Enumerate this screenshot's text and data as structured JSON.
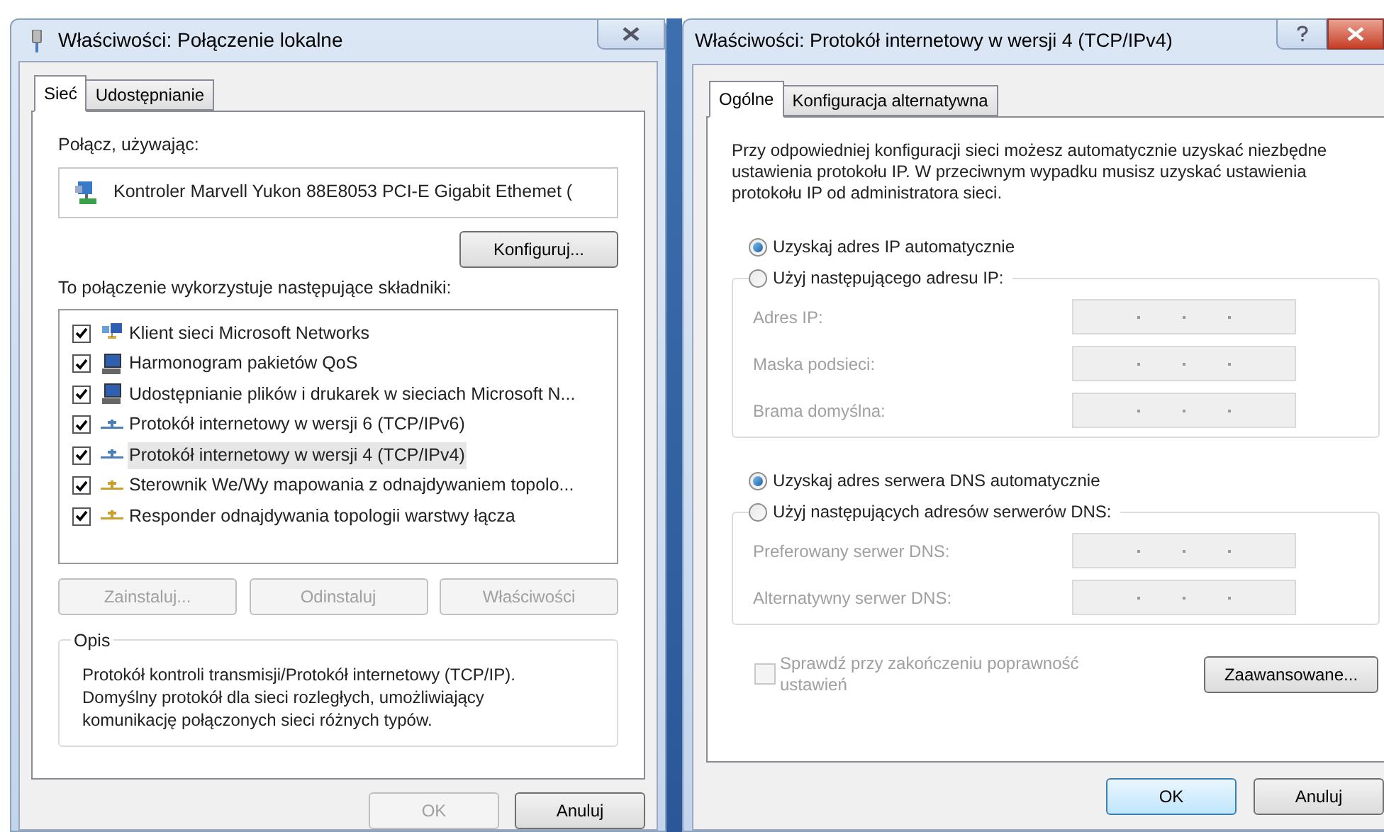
{
  "left_window": {
    "title": "Właściwości: Połączenie lokalne",
    "tabs": [
      {
        "label": "Sieć",
        "selected": true
      },
      {
        "label": "Udostępnianie",
        "selected": false
      }
    ],
    "connect_using_label": "Połącz, używając:",
    "adapter": "Kontroler Marvell Yukon 88E8053 PCI-E Gigabit Ethemet (",
    "configure_button": "Konfiguruj...",
    "components_label": "To połączenie wykorzystuje następujące składniki:",
    "components": [
      {
        "label": "Klient sieci Microsoft Networks",
        "checked": true,
        "selected": false,
        "kind": "client"
      },
      {
        "label": "Harmonogram pakietów QoS",
        "checked": true,
        "selected": false,
        "kind": "computer"
      },
      {
        "label": "Udostępnianie plików i drukarek w sieciach Microsoft N...",
        "checked": true,
        "selected": false,
        "kind": "computer"
      },
      {
        "label": "Protokół internetowy w wersji 6 (TCP/IPv6)",
        "checked": true,
        "selected": false,
        "kind": "ip-protocol"
      },
      {
        "label": "Protokół internetowy w wersji 4 (TCP/IPv4)",
        "checked": true,
        "selected": true,
        "kind": "ip-protocol"
      },
      {
        "label": "Sterownik We/Wy mapowania z odnajdywaniem topolo...",
        "checked": true,
        "selected": false,
        "kind": "protocol"
      },
      {
        "label": "Responder odnajdywania topologii warstwy łącza",
        "checked": true,
        "selected": false,
        "kind": "protocol"
      }
    ],
    "component_buttons": [
      {
        "label": "Zainstaluj...",
        "disabled": true
      },
      {
        "label": "Odinstaluj",
        "disabled": true
      },
      {
        "label": "Właściwości",
        "disabled": true
      }
    ],
    "description_title": "Opis",
    "description": "Protokół kontroli transmisji/Protokół internetowy (TCP/IP). Domyślny protokół dla sieci rozległych, umożliwiający komunikację połączonych sieci różnych typów.",
    "buttons": [
      {
        "label": "OK",
        "disabled": true
      },
      {
        "label": "Anuluj",
        "disabled": false
      }
    ]
  },
  "right_window": {
    "title": "Właściwości: Protokół internetowy w wersji 4 (TCP/IPv4)",
    "tabs": [
      {
        "label": "Ogólne",
        "selected": true
      },
      {
        "label": "Konfiguracja alternatywna",
        "selected": false
      }
    ],
    "intro": "Przy odpowiedniej konfiguracji sieci możesz automatycznie uzyskać niezbędne ustawienia protokołu IP. W przeciwnym wypadku musisz uzyskać ustawienia protokołu IP od administratora sieci.",
    "ip_groups": [
      {
        "auto_option": {
          "label": "Uzyskaj adres IP automatycznie",
          "selected": true
        },
        "manual_option": {
          "label": "Użyj następującego adresu IP:",
          "selected": false
        },
        "fields": [
          {
            "label": "Adres IP:",
            "disabled": true
          },
          {
            "label": "Maska podsieci:",
            "disabled": true
          },
          {
            "label": "Brama domyślna:",
            "disabled": true
          }
        ]
      },
      {
        "auto_option": {
          "label": "Uzyskaj adres serwera DNS automatycznie",
          "selected": true
        },
        "manual_option": {
          "label": "Użyj następujących adresów serwerów DNS:",
          "selected": false
        },
        "fields": [
          {
            "label": "Preferowany serwer DNS:",
            "disabled": true
          },
          {
            "label": "Alternatywny serwer DNS:",
            "disabled": true
          }
        ]
      }
    ],
    "validate_checkbox": {
      "label": "Sprawdź przy zakończeniu poprawność ustawień",
      "checked": false,
      "disabled": true
    },
    "advanced_button": "Zaawansowane...",
    "buttons": [
      {
        "label": "OK",
        "default": true
      },
      {
        "label": "Anuluj",
        "default": false
      }
    ]
  }
}
